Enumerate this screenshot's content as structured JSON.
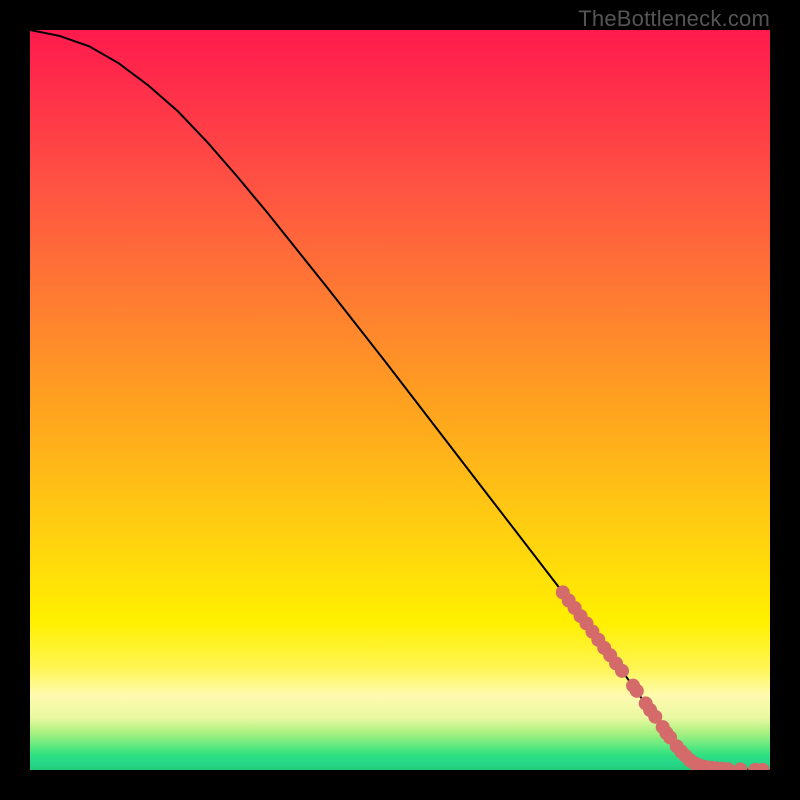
{
  "watermark": "TheBottleneck.com",
  "colors": {
    "curve": "#000000",
    "marker_fill": "#d46a6a",
    "marker_stroke": "#b84f4f"
  },
  "chart_data": {
    "type": "line",
    "title": "",
    "xlabel": "",
    "ylabel": "",
    "xlim": [
      0,
      100
    ],
    "ylim": [
      0,
      100
    ],
    "curve": {
      "x": [
        0,
        4,
        8,
        12,
        16,
        20,
        24,
        28,
        32,
        36,
        40,
        44,
        48,
        52,
        56,
        60,
        64,
        68,
        72,
        76,
        80,
        84,
        86,
        88,
        89,
        90,
        92,
        94,
        96,
        98,
        100
      ],
      "y": [
        100,
        99.2,
        97.8,
        95.5,
        92.5,
        89,
        84.8,
        80.2,
        75.4,
        70.4,
        65.4,
        60.3,
        55.2,
        50,
        44.8,
        39.6,
        34.4,
        29.2,
        24,
        18.8,
        13.4,
        7.8,
        5,
        2.4,
        1.4,
        0.8,
        0.35,
        0.15,
        0.06,
        0.02,
        0
      ]
    },
    "markers": [
      {
        "x": 72.0,
        "y": 24.0
      },
      {
        "x": 72.8,
        "y": 22.9
      },
      {
        "x": 73.6,
        "y": 21.9
      },
      {
        "x": 74.4,
        "y": 20.8
      },
      {
        "x": 75.2,
        "y": 19.8
      },
      {
        "x": 76.0,
        "y": 18.7
      },
      {
        "x": 76.8,
        "y": 17.6
      },
      {
        "x": 77.6,
        "y": 16.5
      },
      {
        "x": 78.4,
        "y": 15.5
      },
      {
        "x": 79.2,
        "y": 14.4
      },
      {
        "x": 80.0,
        "y": 13.4
      },
      {
        "x": 81.5,
        "y": 11.4
      },
      {
        "x": 82.0,
        "y": 10.7
      },
      {
        "x": 83.2,
        "y": 9.0
      },
      {
        "x": 83.8,
        "y": 8.1
      },
      {
        "x": 84.5,
        "y": 7.2
      },
      {
        "x": 85.5,
        "y": 5.8
      },
      {
        "x": 86.0,
        "y": 5.0
      },
      {
        "x": 86.5,
        "y": 4.4
      },
      {
        "x": 87.4,
        "y": 3.2
      },
      {
        "x": 88.0,
        "y": 2.5
      },
      {
        "x": 88.6,
        "y": 1.9
      },
      {
        "x": 89.2,
        "y": 1.3
      },
      {
        "x": 89.8,
        "y": 0.9
      },
      {
        "x": 90.5,
        "y": 0.6
      },
      {
        "x": 91.2,
        "y": 0.4
      },
      {
        "x": 92.0,
        "y": 0.3
      },
      {
        "x": 92.8,
        "y": 0.22
      },
      {
        "x": 93.5,
        "y": 0.17
      },
      {
        "x": 94.3,
        "y": 0.12
      },
      {
        "x": 96.0,
        "y": 0.06
      },
      {
        "x": 98.0,
        "y": 0.02
      },
      {
        "x": 99.0,
        "y": 0.01
      }
    ]
  }
}
